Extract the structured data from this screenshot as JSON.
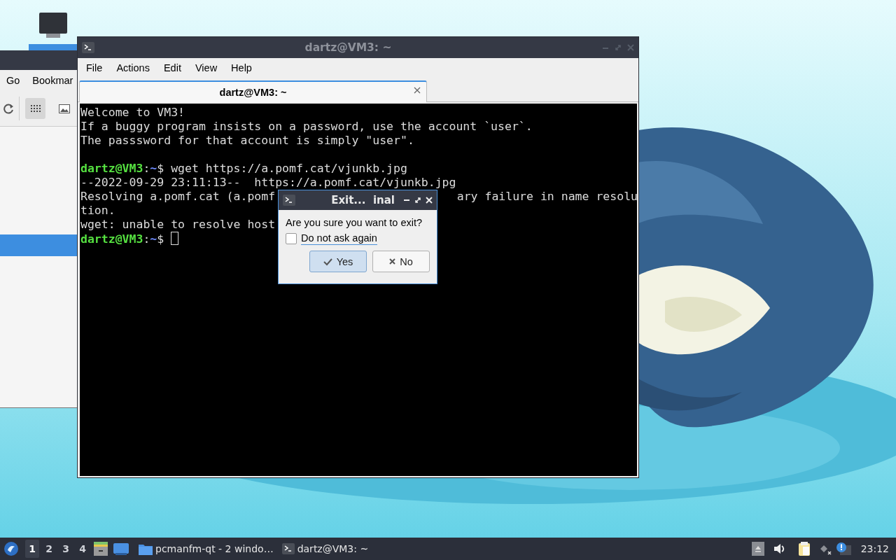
{
  "desktop": {
    "icons": [
      {
        "selected": true
      }
    ]
  },
  "file_manager": {
    "menu": [
      "Go",
      "Bookmar"
    ],
    "view_buttons": [
      {
        "kind": "icons",
        "selected": true
      },
      {
        "kind": "thumbnails",
        "selected": false
      }
    ]
  },
  "terminal": {
    "title": "dartz@VM3: ~",
    "menu": [
      "File",
      "Actions",
      "Edit",
      "View",
      "Help"
    ],
    "tabs": [
      {
        "label": "dartz@VM3: ~",
        "selected": true
      }
    ],
    "lines": [
      {
        "kind": "text",
        "parts": [
          {
            "kind": "plain",
            "text": "Welcome to VM3!"
          }
        ]
      },
      {
        "kind": "text",
        "parts": [
          {
            "kind": "plain",
            "text": "If a buggy program insists on a password, use the account `user`."
          }
        ]
      },
      {
        "kind": "text",
        "parts": [
          {
            "kind": "plain",
            "text": "The passsword for that account is simply \"user\"."
          }
        ]
      },
      {
        "kind": "blank"
      },
      {
        "kind": "text",
        "parts": [
          {
            "kind": "host",
            "text": "dartz@VM3"
          },
          {
            "kind": "plain",
            "text": ":"
          },
          {
            "kind": "path",
            "text": "~"
          },
          {
            "kind": "plain",
            "text": "$ wget https://a.pomf.cat/vjunkb.jpg"
          }
        ]
      },
      {
        "kind": "text",
        "parts": [
          {
            "kind": "plain",
            "text": "--2022-09-29 23:11:13--  https://a.pomf.cat/vjunkb.jpg"
          }
        ]
      },
      {
        "kind": "text",
        "parts": [
          {
            "kind": "plain",
            "text": "Resolving a.pomf.cat (a.pomf"
          }
        ],
        "right": "ary failure in name resolu"
      },
      {
        "kind": "text",
        "parts": [
          {
            "kind": "plain",
            "text": "tion."
          }
        ]
      },
      {
        "kind": "text",
        "parts": [
          {
            "kind": "plain",
            "text": "wget: unable to resolve host"
          }
        ]
      },
      {
        "kind": "text",
        "parts": [
          {
            "kind": "host",
            "text": "dartz@VM3"
          },
          {
            "kind": "plain",
            "text": ":"
          },
          {
            "kind": "path",
            "text": "~"
          },
          {
            "kind": "plain",
            "text": "$ "
          }
        ],
        "cursor": true
      }
    ]
  },
  "dialog": {
    "title": "Exit...  inal",
    "message": "Are you sure you want to exit?",
    "checkbox": {
      "label": "Do not ask again",
      "checked": false
    },
    "buttons": [
      {
        "kind": "yes",
        "label": "Yes",
        "selected": true
      },
      {
        "kind": "no",
        "label": "No",
        "selected": false
      }
    ]
  },
  "taskbar": {
    "workspaces": [
      {
        "label": "1",
        "selected": true
      },
      {
        "label": "2",
        "selected": false
      },
      {
        "label": "3",
        "selected": false
      },
      {
        "label": "4",
        "selected": false
      }
    ],
    "tasks": [
      {
        "kind": "folder",
        "label": "pcmanfm-qt - 2 windo…"
      },
      {
        "kind": "terminal",
        "label": "dartz@VM3: ~"
      }
    ],
    "clock": "23:12"
  }
}
